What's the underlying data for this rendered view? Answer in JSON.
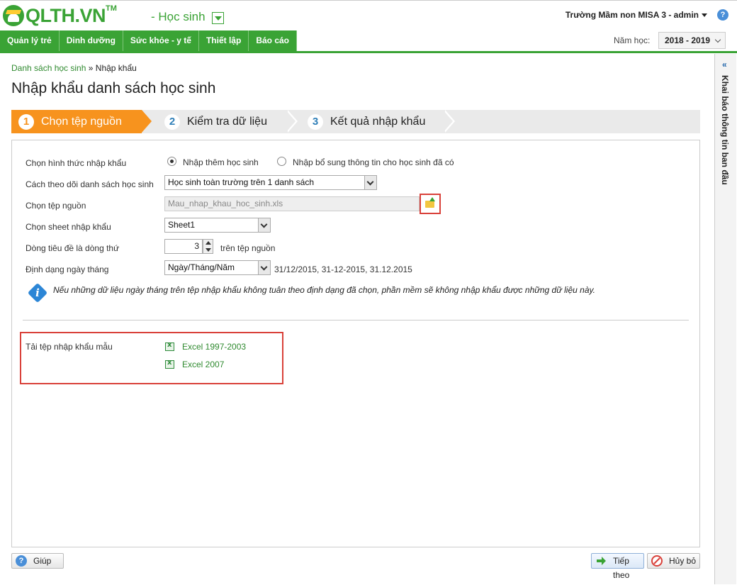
{
  "brand": {
    "logo_text": "QLTH.VN",
    "tm": "TM",
    "module": "- Học sinh"
  },
  "user": {
    "school": "Trường Mầm non MISA 3 - admin"
  },
  "nav": [
    {
      "label": "Quản lý trẻ"
    },
    {
      "label": "Dinh dưỡng"
    },
    {
      "label": "Sức khỏe - y tế"
    },
    {
      "label": "Thiết lập"
    },
    {
      "label": "Báo cáo"
    }
  ],
  "year": {
    "label": "Năm học:",
    "value": "2018 - 2019"
  },
  "side_panel": {
    "title": "Khai báo thông tin ban đầu"
  },
  "breadcrumb": {
    "link": "Danh sách học sinh",
    "separator": "»",
    "current": "Nhập khẩu"
  },
  "page_title": "Nhập khẩu danh sách học sinh",
  "steps": [
    {
      "num": "1",
      "label": "Chọn tệp nguồn"
    },
    {
      "num": "2",
      "label": "Kiểm tra dữ liệu"
    },
    {
      "num": "3",
      "label": "Kết quả nhập khẩu"
    }
  ],
  "form": {
    "import_type_label": "Chọn hình thức nhập khẩu",
    "import_type_option1": "Nhập thêm học sinh",
    "import_type_option2": "Nhập bổ sung thông tin cho học sinh đã có",
    "tracking_label": "Cách theo dõi danh sách học sinh",
    "tracking_value": "Học sinh toàn trường trên 1 danh sách",
    "source_label": "Chọn tệp nguồn",
    "source_value": "Mau_nhap_khau_hoc_sinh.xls",
    "sheet_label": "Chọn sheet nhập khẩu",
    "sheet_value": "Sheet1",
    "header_row_label": "Dòng tiêu đề là dòng thứ",
    "header_row_value": "3",
    "header_row_suffix": "trên tệp nguồn",
    "date_format_label": "Định dạng ngày tháng",
    "date_format_value": "Ngày/Tháng/Năm",
    "date_format_examples": "31/12/2015, 31-12-2015, 31.12.2015",
    "note": "Nếu những dữ liệu ngày tháng trên tệp nhập khẩu không tuân theo định dạng đã chọn, phần mềm sẽ không nhập khẩu được những dữ liệu này.",
    "template_label": "Tải tệp nhập khẩu mẫu",
    "template_link1": "Excel 1997-2003",
    "template_link2": "Excel 2007"
  },
  "footer": {
    "help": "Giúp",
    "next": "Tiếp theo",
    "cancel": "Hủy bỏ"
  },
  "colors": {
    "brand_green": "#3aa335",
    "step_active": "#f7931e",
    "highlight_red": "#d9413a"
  }
}
